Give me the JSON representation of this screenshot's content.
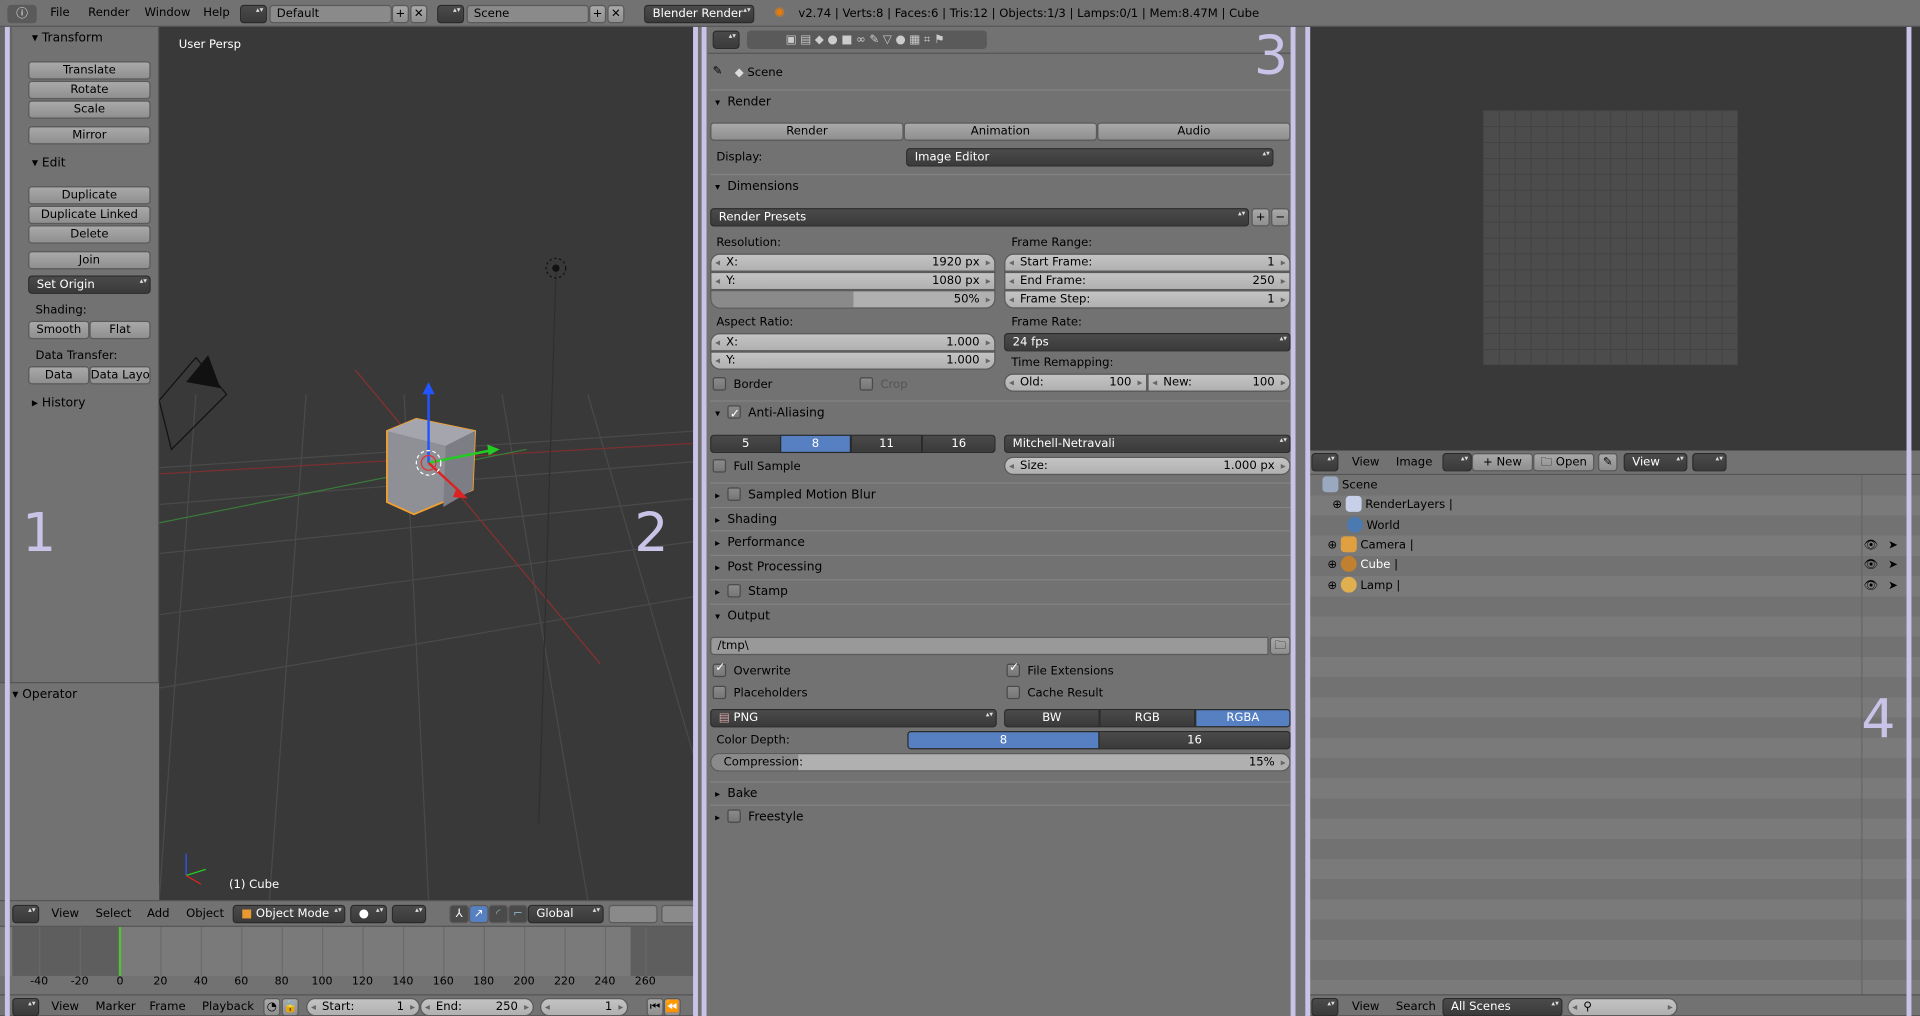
{
  "topbar": {
    "menus": [
      "File",
      "Render",
      "Window",
      "Help"
    ],
    "layout": "Default",
    "scene": "Scene",
    "engine": "Blender Render",
    "stats": "v2.74 | Verts:8 | Faces:6 | Tris:12 | Objects:1/3 | Lamps:0/1 | Mem:8.47M | Cube"
  },
  "toolshelf": {
    "transform": "Transform",
    "translate": "Translate",
    "rotate": "Rotate",
    "scale": "Scale",
    "mirror": "Mirror",
    "edit": "Edit",
    "duplicate": "Duplicate",
    "duplicate_linked": "Duplicate Linked",
    "delete": "Delete",
    "join": "Join",
    "set_origin": "Set Origin",
    "shading_label": "Shading:",
    "smooth": "Smooth",
    "flat": "Flat",
    "data_transfer_label": "Data Transfer:",
    "data": "Data",
    "data_layout": "Data Layo",
    "history": "History",
    "operator": "Operator"
  },
  "viewport": {
    "view_label": "User Persp",
    "object_label": "(1) Cube",
    "menus": [
      "View",
      "Select",
      "Add",
      "Object"
    ],
    "mode": "Object Mode",
    "orientation": "Global"
  },
  "timeline": {
    "ticks": [
      -40,
      -20,
      0,
      20,
      40,
      60,
      80,
      100,
      120,
      140,
      160,
      180,
      200,
      220,
      240,
      260
    ],
    "current_frame": 0,
    "menus": [
      "View",
      "Marker",
      "Frame",
      "Playback"
    ],
    "start_label": "Start:",
    "start": "1",
    "end_label": "End:",
    "end": "250",
    "frame": "1",
    "accent": "#4fc23a"
  },
  "properties": {
    "scene": "Scene",
    "render": {
      "title": "Render",
      "render_btn": "Render",
      "animation_btn": "Animation",
      "audio_btn": "Audio",
      "display_label": "Display:",
      "display": "Image Editor"
    },
    "dimensions": {
      "title": "Dimensions",
      "presets": "Render Presets",
      "resolution_label": "Resolution:",
      "res_x_label": "X:",
      "res_x": "1920 px",
      "res_y_label": "Y:",
      "res_y": "1080 px",
      "res_pct": "50%",
      "res_pct_value": 50,
      "aspect_label": "Aspect Ratio:",
      "asp_x_label": "X:",
      "asp_x": "1.000",
      "asp_y_label": "Y:",
      "asp_y": "1.000",
      "border": "Border",
      "crop": "Crop",
      "frame_range_label": "Frame Range:",
      "start_label": "Start Frame:",
      "start": "1",
      "end_label": "End Frame:",
      "end": "250",
      "step_label": "Frame Step:",
      "step": "1",
      "frame_rate_label": "Frame Rate:",
      "frame_rate": "24 fps",
      "time_remap_label": "Time Remapping:",
      "old_label": "Old:",
      "old": "100",
      "new_label": "New:",
      "new": "100"
    },
    "aa": {
      "title": "Anti-Aliasing",
      "samples": [
        "5",
        "8",
        "11",
        "16"
      ],
      "selected": "8",
      "filter": "Mitchell-Netravali",
      "full_sample": "Full Sample",
      "size_label": "Size:",
      "size": "1.000 px"
    },
    "collapsed": [
      "Sampled Motion Blur",
      "Shading",
      "Performance",
      "Post Processing",
      "Stamp"
    ],
    "output": {
      "title": "Output",
      "path": "/tmp\\",
      "overwrite": "Overwrite",
      "file_extensions": "File Extensions",
      "placeholders": "Placeholders",
      "cache_result": "Cache Result",
      "format": "PNG",
      "color_modes": [
        "BW",
        "RGB",
        "RGBA"
      ],
      "color_mode": "RGBA",
      "depth_label": "Color Depth:",
      "depths": [
        "8",
        "16"
      ],
      "depth": "8",
      "compression_label": "Compression:",
      "compression": "15%",
      "compression_value": 15
    },
    "bake": "Bake",
    "freestyle": "Freestyle"
  },
  "image_editor": {
    "menus": [
      "View",
      "Image"
    ],
    "new": "New",
    "open": "Open",
    "view": "View"
  },
  "outliner": {
    "items": [
      "Scene",
      "RenderLayers",
      "World",
      "Camera",
      "Cube",
      "Lamp"
    ],
    "menus": [
      "View",
      "Search"
    ],
    "filter": "All Scenes"
  },
  "overlays": [
    "1",
    "2",
    "3",
    "4"
  ],
  "colors": {
    "selected": "#5680c2",
    "overlay": "#c9c3e8",
    "viewport_bg": "#393939",
    "selection_outline": "#f0a030"
  }
}
